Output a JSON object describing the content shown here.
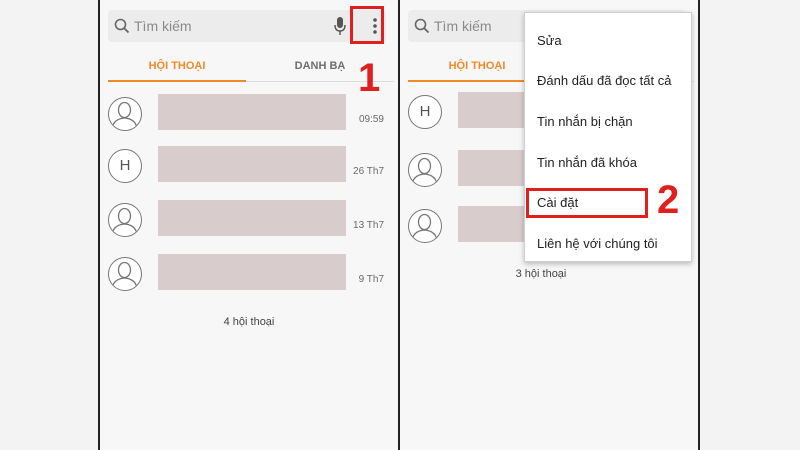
{
  "left_screen": {
    "search": {
      "placeholder": "Tìm kiếm"
    },
    "tabs": [
      {
        "label": "HỘI THOẠI",
        "active": true
      },
      {
        "label": "DANH BẠ",
        "active": false
      }
    ],
    "conversations": [
      {
        "avatar": "person-icon",
        "time": "09:59"
      },
      {
        "avatar_letter": "H",
        "time": "26 Th7"
      },
      {
        "avatar": "person-icon",
        "time": "13 Th7"
      },
      {
        "avatar": "person-icon",
        "time": "9 Th7"
      }
    ],
    "count_label": "4 hội thoại",
    "step_label": "1"
  },
  "right_screen": {
    "search": {
      "placeholder": "Tìm kiếm"
    },
    "tabs": [
      {
        "label": "HỘI THOẠI",
        "active": true
      }
    ],
    "conversations": [
      {
        "avatar_letter": "H"
      },
      {
        "avatar": "person-icon"
      },
      {
        "avatar": "person-icon"
      }
    ],
    "count_label": "3 hội thoại",
    "menu": {
      "items": [
        {
          "label": "Sửa"
        },
        {
          "label": "Đánh dấu đã đọc tất cả"
        },
        {
          "label": "Tin nhắn bị chặn"
        },
        {
          "label": "Tin nhắn đã khóa"
        },
        {
          "label": "Cài đặt",
          "highlighted": true
        },
        {
          "label": "Liên hệ với chúng tôi"
        }
      ]
    },
    "step_label": "2"
  },
  "colors": {
    "accent": "#f08a28",
    "annotation": "#e0201c",
    "redaction": "#d9cccc"
  }
}
